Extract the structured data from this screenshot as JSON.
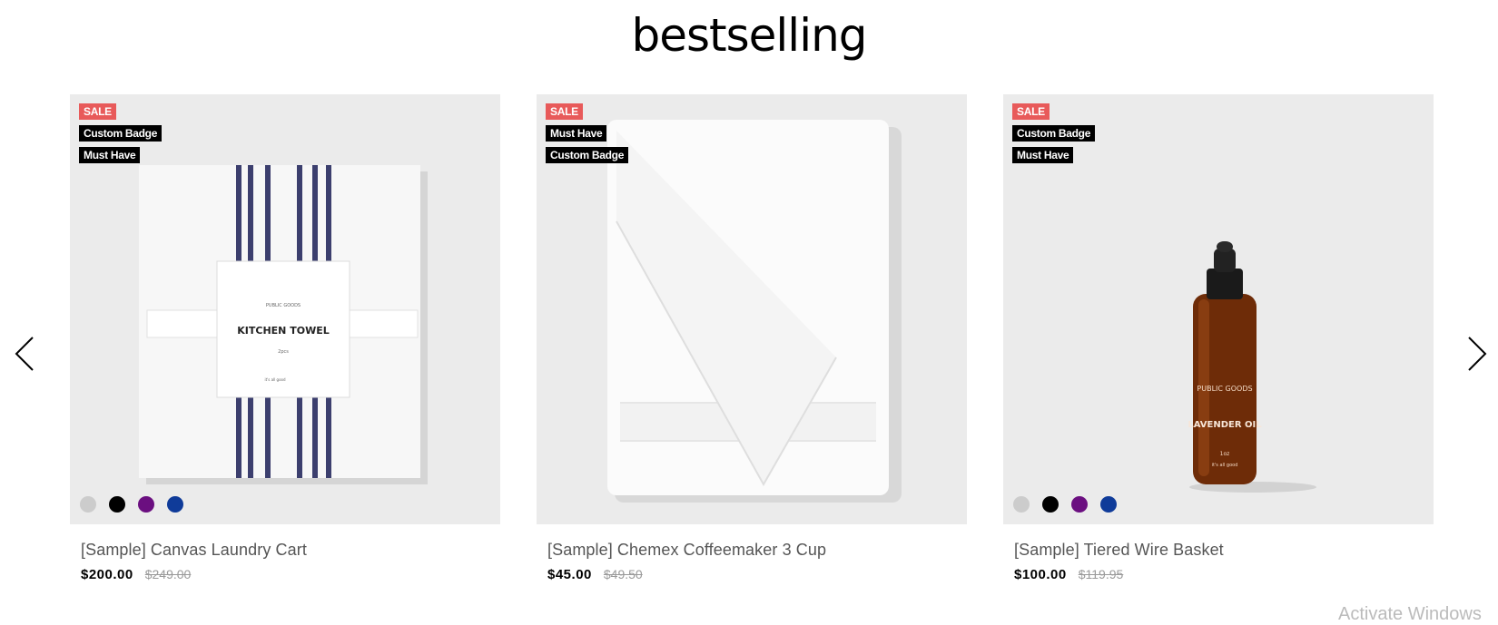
{
  "section": {
    "title": "bestselling"
  },
  "products": [
    {
      "name": "[Sample] Canvas Laundry Cart",
      "price": "$200.00",
      "old_price": "$249.00",
      "badges": [
        {
          "label": "SALE",
          "color": "#e85a5a"
        },
        {
          "label": "Custom Badge",
          "color": "#000000"
        },
        {
          "label": "Must Have",
          "color": "#000000"
        }
      ],
      "swatches": [
        "#cccccc",
        "#000000",
        "#6b0f80",
        "#0f3b99"
      ],
      "image_label": {
        "brand": "PUBLIC GOODS",
        "title": "KITCHEN TOWEL",
        "sub": "2pcs",
        "tag": "it's all good"
      }
    },
    {
      "name": "[Sample] Chemex Coffeemaker 3 Cup",
      "price": "$45.00",
      "old_price": "$49.50",
      "badges": [
        {
          "label": "SALE",
          "color": "#e85a5a"
        },
        {
          "label": "Must Have",
          "color": "#000000"
        },
        {
          "label": "Custom Badge",
          "color": "#000000"
        }
      ],
      "swatches": []
    },
    {
      "name": "[Sample] Tiered Wire Basket",
      "price": "$100.00",
      "old_price": "$119.95",
      "badges": [
        {
          "label": "SALE",
          "color": "#e85a5a"
        },
        {
          "label": "Custom Badge",
          "color": "#000000"
        },
        {
          "label": "Must Have",
          "color": "#000000"
        }
      ],
      "swatches": [
        "#cccccc",
        "#000000",
        "#6b0f80",
        "#0f3b99"
      ],
      "image_label": {
        "brand": "PUBLIC GOODS",
        "title": "LAVENDER OIL",
        "sub": "1oz",
        "tag": "it's all good"
      }
    }
  ],
  "nav": {
    "prev_icon": "chevron-left-icon",
    "next_icon": "chevron-right-icon"
  },
  "watermark": "Activate Windows"
}
